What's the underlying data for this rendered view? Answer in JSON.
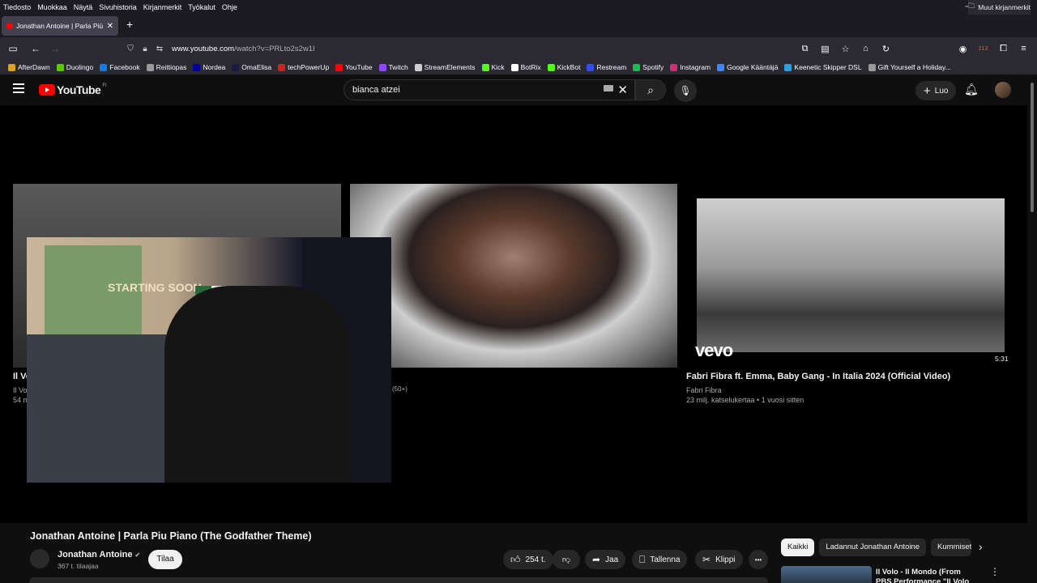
{
  "menubar": {
    "items": [
      "Tiedosto",
      "Muokkaa",
      "Näytä",
      "Sivuhistoria",
      "Kirjanmerkit",
      "Työkalut",
      "Ohje"
    ]
  },
  "window_controls": {
    "minimize": "─",
    "restore": "❐",
    "close": "✕"
  },
  "tab": {
    "title": "Jonathan Antoine | Parla Più Pia",
    "close": "✕",
    "new_tab": "+"
  },
  "address": {
    "domain": "www.youtube.com",
    "path": "/watch?v=PRLto2s2w1I"
  },
  "toolbar_icons": [
    "sidebar-icon",
    "back-icon",
    "forward-icon",
    "shield-icon",
    "lock-icon",
    "permissions-icon",
    "picture-in-picture-icon",
    "reader-icon",
    "star-icon",
    "home-icon",
    "reload-icon",
    "profile-icon",
    "extension-badge-icon",
    "extensions-icon",
    "menu-icon"
  ],
  "extension_badge": "213",
  "bookmarks": [
    {
      "label": "AfterDawn",
      "color": "#e0a020"
    },
    {
      "label": "Duolingo",
      "color": "#58cc02"
    },
    {
      "label": "Facebook",
      "color": "#1877f2"
    },
    {
      "label": "Reittiopas",
      "color": "#9a9a9a"
    },
    {
      "label": "Nordea",
      "color": "#0000a0"
    },
    {
      "label": "OmaElisa",
      "color": "#1a1a40"
    },
    {
      "label": "techPowerUp",
      "color": "#d02020"
    },
    {
      "label": "YouTube",
      "color": "#ff0000"
    },
    {
      "label": "Twitch",
      "color": "#9146ff"
    },
    {
      "label": "StreamElements",
      "color": "#cfcfcf"
    },
    {
      "label": "Kick",
      "color": "#53fc18"
    },
    {
      "label": "BotRix",
      "color": "#ffffff"
    },
    {
      "label": "KickBot",
      "color": "#53fc18"
    },
    {
      "label": "Restream",
      "color": "#3050e0"
    },
    {
      "label": "Spotify",
      "color": "#1db954"
    },
    {
      "label": "Instagram",
      "color": "#d62976"
    },
    {
      "label": "Google Kääntäjä",
      "color": "#4285f4"
    },
    {
      "label": "Keenetic Skipper DSL",
      "color": "#2aa0e0"
    },
    {
      "label": "Gift Yourself a Holiday...",
      "color": "#9a9a9a"
    }
  ],
  "other_bookmarks": "Muut kirjanmerkit",
  "youtube": {
    "logo": "YouTube",
    "region": "FI",
    "search_value": "bianca atzei",
    "create_label": "Luo"
  },
  "end_screen": {
    "card1": {
      "title": "Il Vo",
      "channel": "Il Vo",
      "meta": "54 m"
    },
    "card2": {
      "meta": "(50+)"
    },
    "card3": {
      "title": "Fabri Fibra ft. Emma, Baby Gang - In Italia 2024 (Official Video)",
      "channel": "Fabri Fibra",
      "meta": "23 milj. katselukertaa • 1 vuosi sitten",
      "duration": "5:31",
      "brand": "vevo"
    }
  },
  "overlay": {
    "poster_text": "STARTING SOON"
  },
  "video": {
    "title": "Jonathan Antoine | Parla Piu Piano (The Godfather Theme)",
    "channel": "Jonathan Antoine",
    "verified": "✔",
    "subscribers": "367 t. tilaajaa",
    "subscribe_label": "Tilaa",
    "likes": "254 t.",
    "share_label": "Jaa",
    "save_label": "Tallenna",
    "clip_label": "Klippi",
    "more": "•••"
  },
  "related": {
    "chips": [
      "Kaikki",
      "Ladannut Jonathan Antoine",
      "Kummisetä"
    ],
    "first_title": "Il Volo - Il Mondo (From PBS Performance \"Il Volo - Taken"
  }
}
